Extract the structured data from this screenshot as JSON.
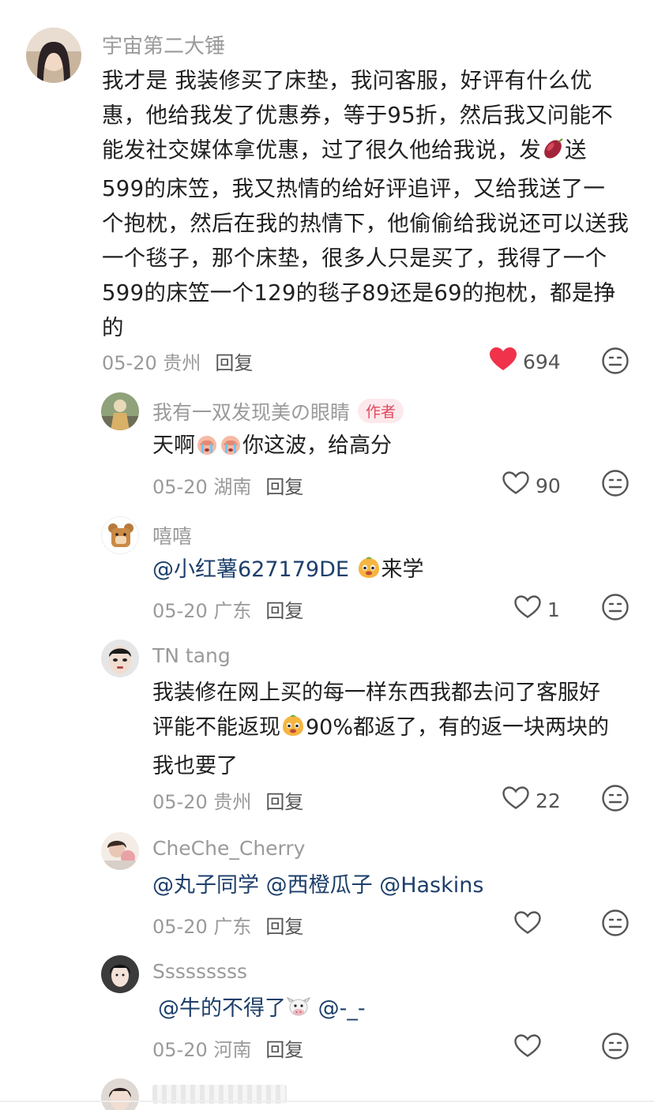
{
  "comments": [
    {
      "username": "宇宙第二大锤",
      "lines": [
        "我才是 我装修买了床垫，我问客服，好评有什么优",
        "惠，他给我发了优惠券，等于95折，然后我又问能不",
        "能发社交媒体拿优惠，过了很久他给我说，发",
        "送",
        "599的床笠，我又热情的给好评追评，又给我送了一",
        "个抱枕，然后在我的热情下，他偷偷给我说还可以送我",
        "一个毯子，那个床垫，很多人只是买了，我得了一个",
        "599的床笠一个129的毯子89还是69的抱枕，都是挣",
        "的"
      ],
      "date": "05-20",
      "location": "贵州",
      "reply": "回复",
      "likes": "694"
    },
    {
      "username": "我有一双发现美の眼睛",
      "badge": "作者",
      "text_a": "天啊",
      "text_b": "你这波，给高分",
      "date": "05-20",
      "location": "湖南",
      "reply": "回复",
      "likes": "90"
    },
    {
      "username": "嘻嘻",
      "mention": "@小红薯627179DE",
      "text_after": "来学",
      "date": "05-20",
      "location": "广东",
      "reply": "回复",
      "likes": "1"
    },
    {
      "username": "TN tang",
      "line1": "我装修在网上买的每一样东西我都去问了客服好",
      "line2_a": "评能不能返现",
      "line2_b": "90%都返了，有的返一块两块的",
      "line3": "我也要了",
      "date": "05-20",
      "location": "贵州",
      "reply": "回复",
      "likes": "22"
    },
    {
      "username": "CheChe_Cherry",
      "mentions": [
        "@丸子同学",
        "@西橙瓜子",
        "@Haskins"
      ],
      "date": "05-20",
      "location": "广东",
      "reply": "回复"
    },
    {
      "username": "Sssssssss",
      "mention1": "@牛的不得了",
      "mention2": "@-_-",
      "date": "05-20",
      "location": "河南",
      "reply": "回复"
    }
  ],
  "icons": {
    "like": "heart-outline-icon",
    "liked": "heart-filled-icon",
    "dislike": "meh-face-icon",
    "sweet_potato": "sweet-potato-emoji-icon",
    "crying": "crying-emoji-icon",
    "smile": "smile-emoji-icon",
    "cow": "cow-emoji-icon"
  },
  "colors": {
    "liked": "#f0324a",
    "author_badge": "#e0495f",
    "mention": "#1d3f6b"
  }
}
